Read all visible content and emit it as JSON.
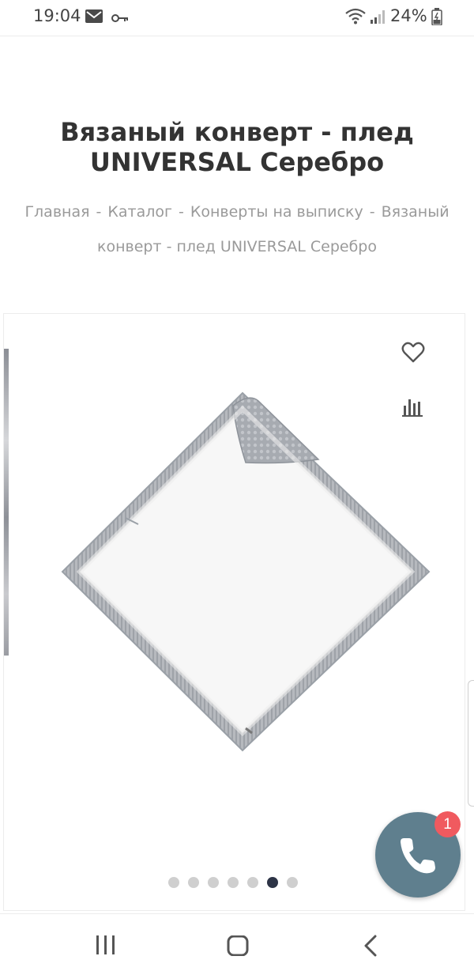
{
  "status_bar": {
    "time": "19:04",
    "battery": "24%",
    "icons": [
      "mail-icon",
      "key-icon",
      "wifi-icon",
      "signal-icon",
      "battery-icon"
    ]
  },
  "product": {
    "title": "Вязаный конверт - плед UNIVERSAL Серебро"
  },
  "breadcrumb": {
    "items": [
      "Главная",
      "Каталог",
      "Конверты на выписку",
      "Вязаный конверт - плед UNIVERSAL Серебро"
    ],
    "separator": "-"
  },
  "gallery": {
    "image": "knitted-blanket-diamond",
    "dot_count": 7,
    "active_dot": 6,
    "actions": [
      "heart-icon",
      "compare-chart-icon"
    ]
  },
  "call_widget": {
    "badge_count": "1",
    "color": "#5f7f8e",
    "badge_color": "#f05a5f"
  },
  "navigation": {
    "buttons": [
      "recents-icon",
      "home-icon",
      "back-icon"
    ]
  }
}
